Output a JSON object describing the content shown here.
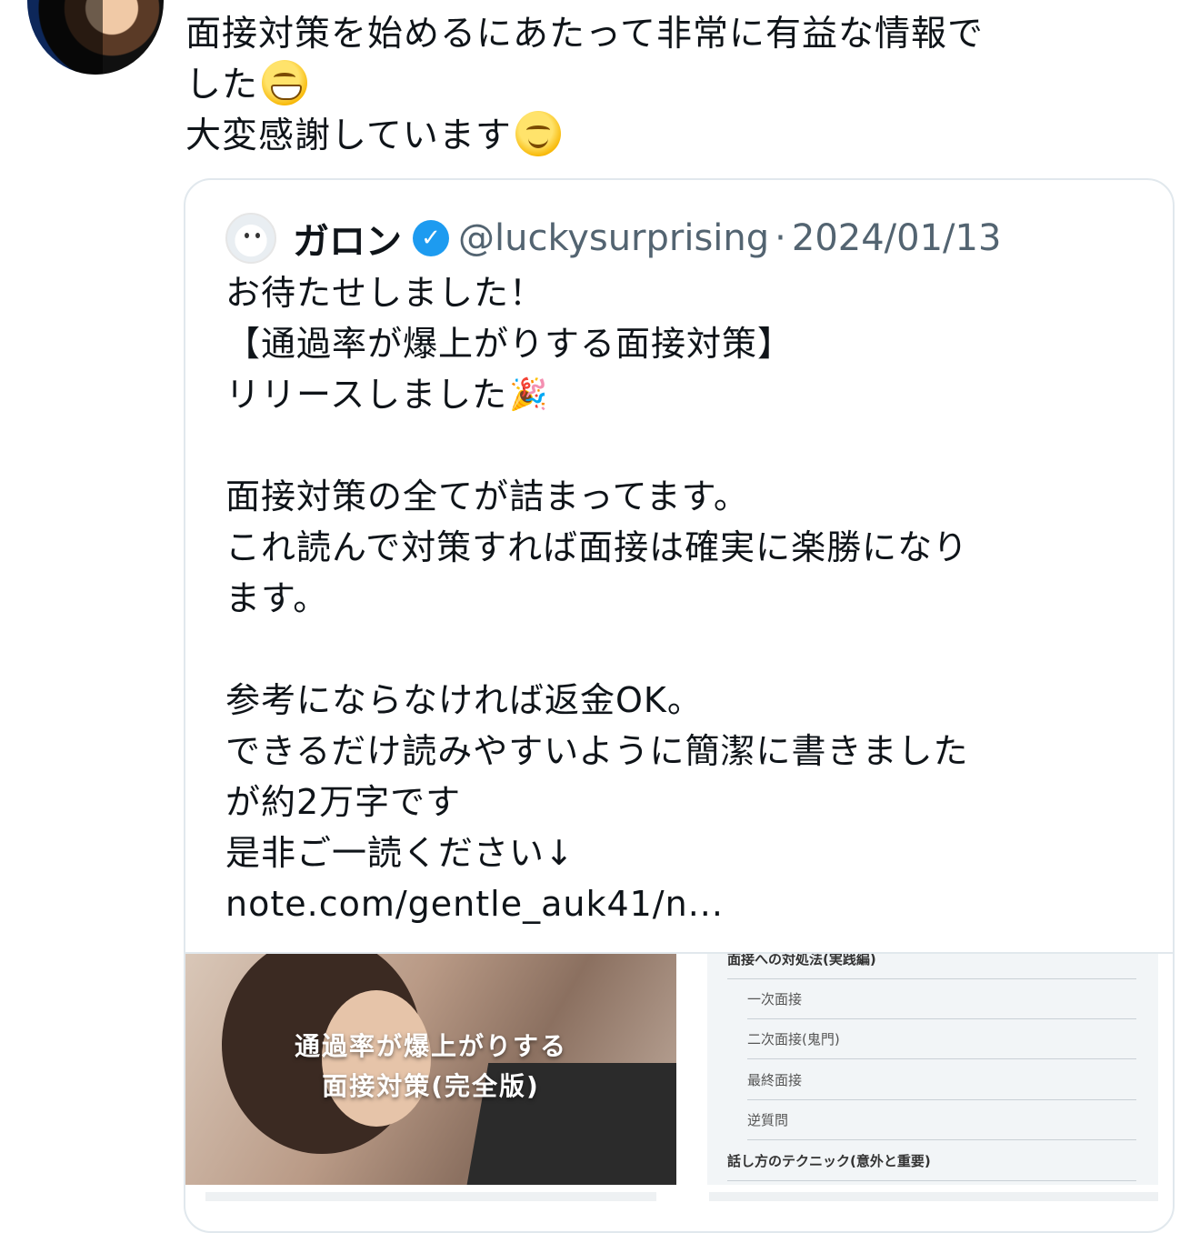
{
  "post": {
    "lines": [
      "面接対策を始めるにあたって非常に有益な情報で",
      "した",
      "大変感謝しています"
    ],
    "emoji_1": "grinning-face-with-smiling-eyes-emoji",
    "emoji_2": "smiling-face-with-smiling-eyes-emoji"
  },
  "quote": {
    "name": "ガロン",
    "handle": "@luckysurprising",
    "separator": "·",
    "date": "2024/01/13",
    "lines": [
      "お待たせしました！",
      "【通過率が爆上がりする面接対策】",
      "リリースしました",
      "",
      "面接対策の全てが詰まってます。",
      "これ読んで対策すれば面接は確実に楽勝になり",
      "ます。",
      "",
      "参考にならなければ返金OK。",
      "できるだけ読みやすいように簡潔に書きました",
      "が約2万字です",
      "是非ご一読ください↓",
      "note.com/gentle_auk41/n..."
    ],
    "party_emoji": "🎉"
  },
  "media": {
    "cover_title_1": "通過率が爆上がりする",
    "cover_title_2": "面接対策(完全版)",
    "toc": [
      "面接への対処法(実践編)",
      "一次面接",
      "二次面接(鬼門)",
      "最終面接",
      "逆質問",
      "話し方のテクニック(意外と重要)"
    ]
  }
}
